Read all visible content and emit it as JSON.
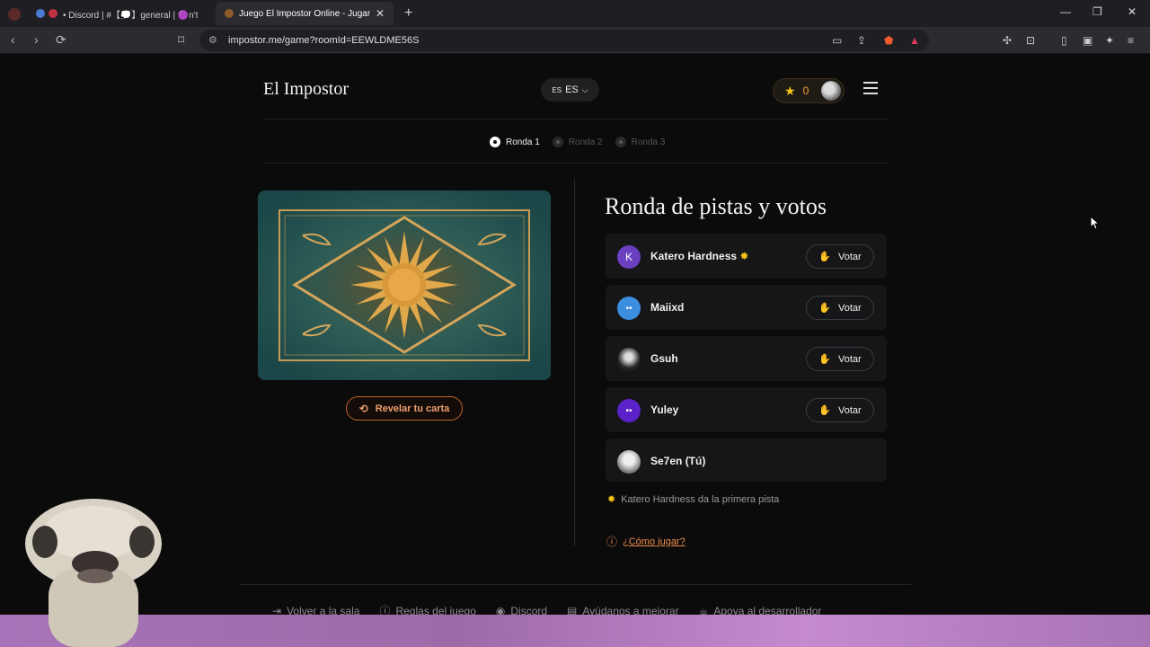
{
  "browser": {
    "tabs": [
      {
        "title": "• Discord | #【💭】general | 🟣n't"
      },
      {
        "title": "Juego El Impostor Online - Jugar"
      }
    ],
    "url": "impostor.me/game?roomId=EEWLDME56S"
  },
  "header": {
    "logo": "El Impostor",
    "lang_small": "ES",
    "lang": "ES",
    "score": "0"
  },
  "rounds": [
    {
      "label": "Ronda 1",
      "active": true
    },
    {
      "label": "Ronda 2",
      "active": false
    },
    {
      "label": "Ronda 3",
      "active": false
    }
  ],
  "card": {
    "reveal_label": "Revelar tu carta"
  },
  "main": {
    "title": "Ronda de pistas y votos",
    "vote_label": "Votar",
    "players": [
      {
        "name": "Katero Hardness",
        "initial": "K",
        "color": "#6a3fc0"
      },
      {
        "name": "Maiixd",
        "initial": "",
        "color": "#3b8ee0"
      },
      {
        "name": "Gsuh",
        "initial": "",
        "color": "#333333"
      },
      {
        "name": "Yuley",
        "initial": "",
        "color": "#5a22c8"
      },
      {
        "name": "Se7en (Tú)",
        "initial": "",
        "color": "#cccccc"
      }
    ],
    "hint": "Katero Hardness da la primera pista",
    "howto": "¿Cómo jugar?"
  },
  "footer": [
    {
      "label": "Volver a la sala",
      "icon": "exit-icon"
    },
    {
      "label": "Reglas del juego",
      "icon": "info-icon"
    },
    {
      "label": "Discord",
      "icon": "discord-icon"
    },
    {
      "label": "Ayúdanos a mejorar",
      "icon": "chat-icon"
    },
    {
      "label": "Apoya al desarrollador",
      "icon": "coffee-icon"
    }
  ],
  "colors": {
    "accent": "#f08a4a",
    "star": "#f5c518"
  }
}
